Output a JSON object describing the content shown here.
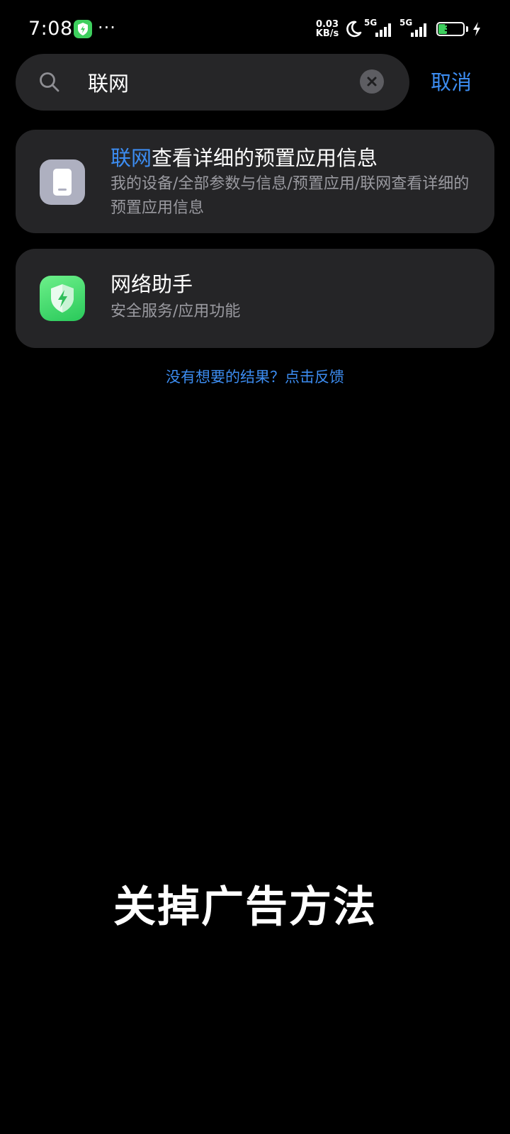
{
  "status_bar": {
    "time": "7:08",
    "overflow": "···",
    "net_speed_value": "0.03",
    "net_speed_unit": "KB/s",
    "signal_1_label": "5G",
    "signal_2_label": "5G",
    "battery_level": "38",
    "battery_percent": 38,
    "battery_color": "#3ecf5e",
    "icons": [
      "security-app-icon",
      "moon-icon",
      "signal-icon",
      "battery-icon",
      "charging-icon"
    ]
  },
  "search": {
    "query": "联网",
    "cancel_label": "取消"
  },
  "results": [
    {
      "icon": "device-icon",
      "title_highlight": "联网",
      "title_rest": "查看详细的预置应用信息",
      "path": "我的设备/全部参数与信息/预置应用/联网查看详细的预置应用信息"
    },
    {
      "icon": "shield-bolt-icon",
      "title_highlight": "",
      "title_rest": "网络助手",
      "path": "安全服务/应用功能"
    }
  ],
  "feedback": {
    "label": "没有想要的结果？点击反馈"
  },
  "overlay": {
    "caption": "关掉广告方法"
  },
  "colors": {
    "accent": "#3c8cf0",
    "card": "#252527",
    "search_bg": "#262628",
    "secondary_text": "#9a9aa0"
  }
}
